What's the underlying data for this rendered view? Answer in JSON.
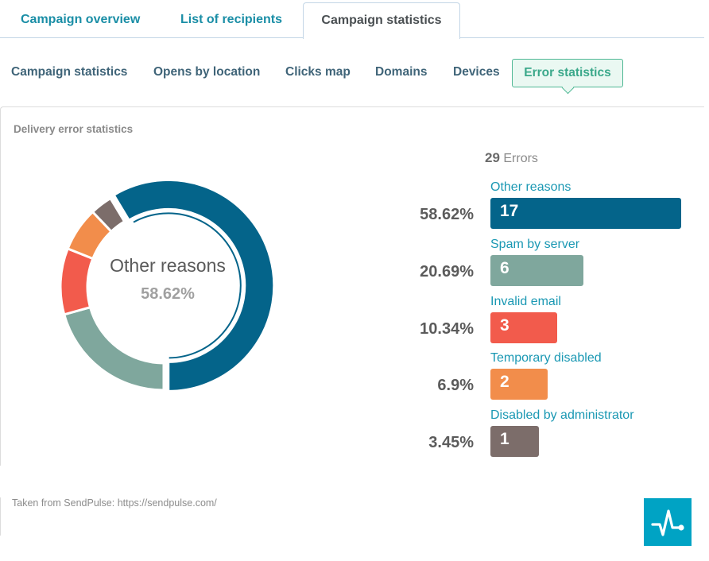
{
  "top_tabs": [
    {
      "label": "Campaign overview",
      "active": false
    },
    {
      "label": "List of recipients",
      "active": false
    },
    {
      "label": "Campaign statistics",
      "active": true
    }
  ],
  "sub_tabs": [
    {
      "label": "Campaign statistics",
      "active": false
    },
    {
      "label": "Opens by location",
      "active": false
    },
    {
      "label": "Clicks map",
      "active": false
    },
    {
      "label": "Domains",
      "active": false
    },
    {
      "label": "Devices",
      "active": false
    },
    {
      "label": "Error statistics",
      "active": true
    }
  ],
  "card": {
    "title": "Delivery error statistics",
    "total_count": "29",
    "total_label": "Errors"
  },
  "footer": {
    "text": "Taken from SendPulse: https://sendpulse.com/",
    "logo_icon": "pulse-icon"
  },
  "chart_data": {
    "type": "pie",
    "variant": "donut",
    "title": "Delivery error statistics",
    "total": 29,
    "highlighted": "Other reasons",
    "center_label": "Other reasons",
    "center_value": "58.62%",
    "categories": [
      "Other reasons",
      "Spam by server",
      "Invalid email",
      "Temporary disabled",
      "Disabled by administrator"
    ],
    "values": [
      17,
      6,
      3,
      2,
      1
    ],
    "percent_labels": [
      "58.62%",
      "20.69%",
      "10.34%",
      "6.9%",
      "3.45%"
    ],
    "colors": [
      "#04648a",
      "#7fa79d",
      "#f25b4c",
      "#f28d4b",
      "#7c6d6a"
    ]
  }
}
